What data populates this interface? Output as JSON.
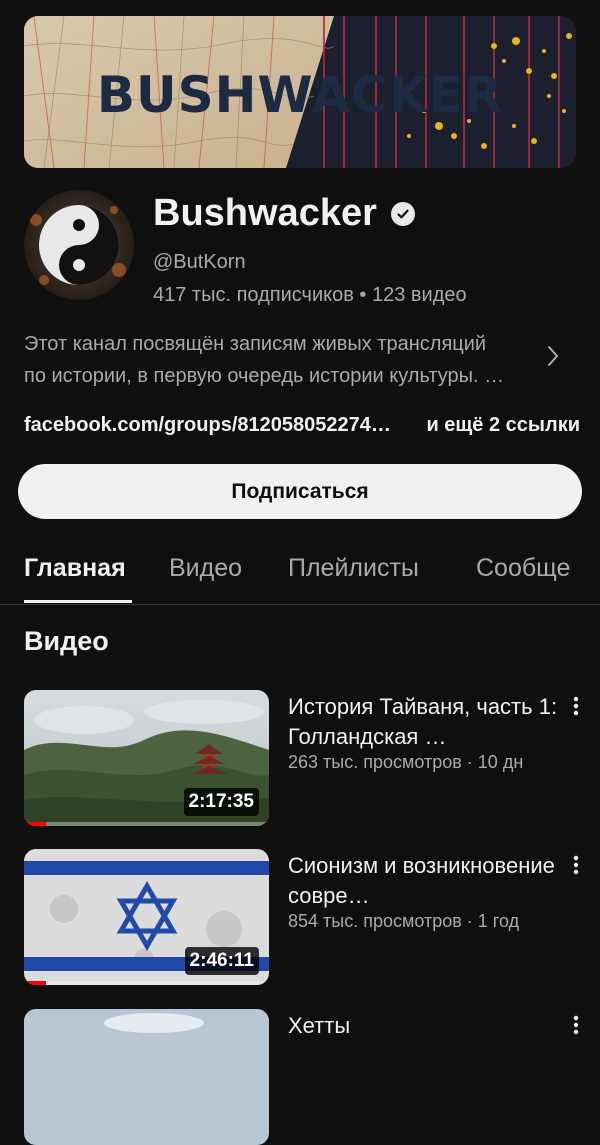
{
  "banner": {
    "title": "BUSHWACKER"
  },
  "channel": {
    "name": "Bushwacker",
    "handle": "@ButKorn",
    "stats": "417 тыс. подписчиков • 123 видео",
    "description_line1": "Этот канал посвящён записям живых трансляций",
    "description_line2": "по истории, в первую очередь истории культуры. …",
    "link": "facebook.com/groups/812058052274…",
    "more_links": "и ещё 2 ссылки",
    "subscribe_label": "Подписаться"
  },
  "tabs": [
    {
      "label": "Главная",
      "active": true
    },
    {
      "label": "Видео"
    },
    {
      "label": "Плейлисты"
    },
    {
      "label": "Сообще"
    }
  ],
  "section_title": "Видео",
  "videos": [
    {
      "title": "История Тайваня, часть 1: Голландская …",
      "meta": "263 тыс. просмотров · 10 дн",
      "duration": "2:17:35",
      "watched_fraction": 0.09
    },
    {
      "title": "Сионизм и возникновение совре…",
      "meta": "854 тыс. просмотров · 1 год",
      "duration": "2:46:11",
      "watched_fraction": 0.09
    },
    {
      "title": "Хетты",
      "meta": "",
      "duration": ""
    }
  ],
  "colors": {
    "background": "#0f0f0f",
    "text_primary": "#f1f1f1",
    "text_secondary": "#aaaaaa",
    "progress_red": "#ff0000",
    "flag_blue": "#1f4aa8"
  },
  "icons": [
    "verified-check-icon",
    "chevron-right-icon",
    "more-vert-icon"
  ]
}
